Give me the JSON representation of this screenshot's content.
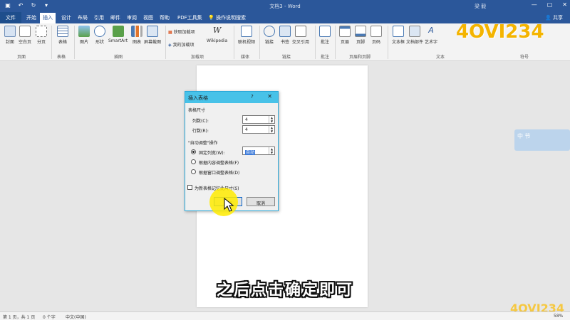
{
  "window": {
    "title": "文档3 - Word",
    "user": "梁 毅",
    "controls": [
      "—",
      "▢",
      "✕"
    ]
  },
  "quick_access": [
    "save",
    "undo",
    "redo",
    "customize"
  ],
  "tabs": {
    "file": "文件",
    "items": [
      "开始",
      "插入",
      "设计",
      "布局",
      "引用",
      "邮件",
      "审阅",
      "视图",
      "帮助",
      "PDF工具集"
    ],
    "active": "插入",
    "search": "操作说明搜索",
    "share": "共享"
  },
  "ribbon": {
    "buttons": [
      {
        "label": "封面",
        "icon": "cover-page-icon"
      },
      {
        "label": "空白页",
        "icon": "blank-page-icon"
      },
      {
        "label": "分页",
        "icon": "page-break-icon"
      },
      {
        "label": "表格",
        "icon": "table-icon"
      },
      {
        "label": "图片",
        "icon": "picture-icon"
      },
      {
        "label": "形状",
        "icon": "shapes-icon"
      },
      {
        "label": "SmartArt",
        "icon": "smartart-icon"
      },
      {
        "label": "图表",
        "icon": "chart-icon"
      },
      {
        "label": "屏幕截图",
        "icon": "screenshot-icon"
      },
      {
        "label": "Wikipedia",
        "icon": "wikipedia-icon"
      },
      {
        "label": "联机视频",
        "icon": "online-video-icon"
      },
      {
        "label": "链接",
        "icon": "link-icon"
      },
      {
        "label": "书签",
        "icon": "bookmark-icon"
      },
      {
        "label": "交叉引用",
        "icon": "cross-reference-icon"
      },
      {
        "label": "批注",
        "icon": "comment-icon"
      },
      {
        "label": "页眉",
        "icon": "header-icon"
      },
      {
        "label": "页脚",
        "icon": "footer-icon"
      },
      {
        "label": "页码",
        "icon": "page-number-icon"
      },
      {
        "label": "文本框",
        "icon": "textbox-icon"
      },
      {
        "label": "文档部件",
        "icon": "quick-parts-icon"
      },
      {
        "label": "艺术字",
        "icon": "wordart-icon"
      }
    ],
    "addins": {
      "get": "获取加载项",
      "mine": "我的加载项"
    },
    "groups": [
      "页面",
      "表格",
      "插图",
      "加载项",
      "媒体",
      "链接",
      "批注",
      "页眉和页脚",
      "文本",
      "符号"
    ]
  },
  "dialog": {
    "title": "插入表格",
    "help": "?",
    "close": "✕",
    "size_section": "表格尺寸",
    "columns_label": "列数(C):",
    "columns_value": "4",
    "rows_label": "行数(R):",
    "rows_value": "4",
    "autofit_section": "\"自动调整\"操作",
    "fixed_width_label": "固定列宽(W):",
    "fixed_width_value": "自动",
    "fit_contents_label": "根据内容调整表格(F)",
    "fit_window_label": "根据窗口调整表格(D)",
    "remember_label": "为新表格记忆此尺寸(S)",
    "ok": "确定",
    "cancel": "取消"
  },
  "status": {
    "page": "第 1 页，共 1 页",
    "words": "0 个字",
    "language": "中文(中国)",
    "zoom": "58%"
  },
  "caption": "之后点击确定即可",
  "watermark": "4OVI234",
  "colors": {
    "accent": "#2b579a",
    "dialog_title": "#48c2e8",
    "highlight": "#ffeb00"
  }
}
